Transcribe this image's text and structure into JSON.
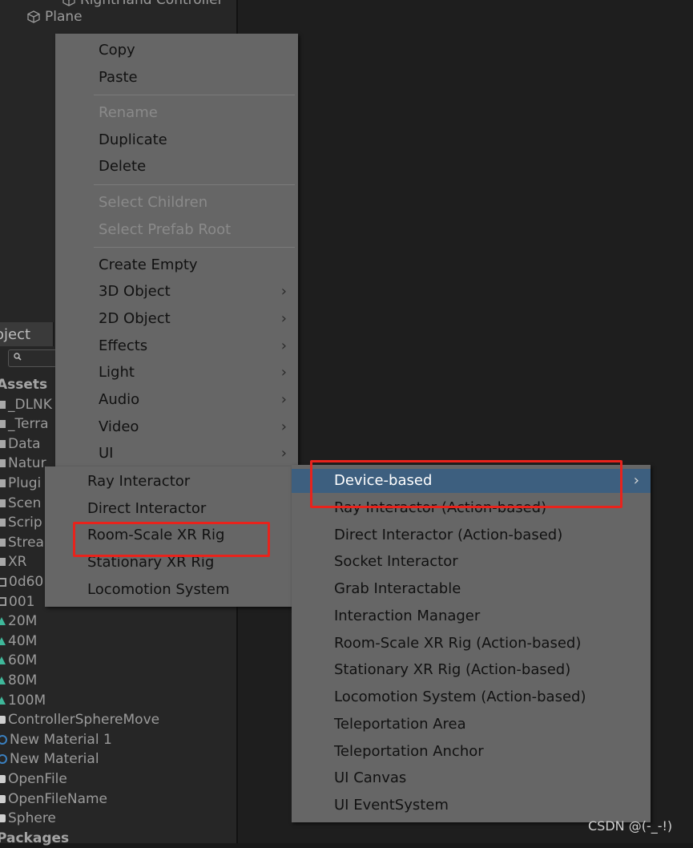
{
  "hierarchy": {
    "items": [
      {
        "label": "RightHand Controller",
        "icon": "cube-icon"
      },
      {
        "label": "Plane",
        "icon": "cube-icon"
      }
    ]
  },
  "project": {
    "tab_label": "oject",
    "search_icon": "search-icon",
    "items": [
      {
        "label": "Assets",
        "type": "header"
      },
      {
        "label": "_DLNK",
        "type": "folder"
      },
      {
        "label": "_Terra",
        "type": "folder"
      },
      {
        "label": "Data",
        "type": "folder"
      },
      {
        "label": "Natur",
        "type": "folder"
      },
      {
        "label": "Plugi",
        "type": "folder"
      },
      {
        "label": "Scen",
        "type": "folder"
      },
      {
        "label": "Scrip",
        "type": "folder"
      },
      {
        "label": "Strea",
        "type": "folder"
      },
      {
        "label": "XR",
        "type": "folder"
      },
      {
        "label": "0d60",
        "type": "mesh"
      },
      {
        "label": "001",
        "type": "mesh"
      },
      {
        "label": "20M",
        "type": "terrain"
      },
      {
        "label": "40M",
        "type": "terrain"
      },
      {
        "label": "60M",
        "type": "terrain"
      },
      {
        "label": "80M",
        "type": "terrain"
      },
      {
        "label": "100M",
        "type": "terrain"
      },
      {
        "label": "ControllerSphereMove",
        "type": "script"
      },
      {
        "label": "New Material 1",
        "type": "material"
      },
      {
        "label": "New Material",
        "type": "material"
      },
      {
        "label": "OpenFile",
        "type": "script"
      },
      {
        "label": "OpenFileName",
        "type": "script"
      },
      {
        "label": "Sphere",
        "type": "script"
      },
      {
        "label": "Packages",
        "type": "header"
      }
    ]
  },
  "main_menu": {
    "items": [
      {
        "label": "Copy",
        "enabled": true
      },
      {
        "label": "Paste",
        "enabled": true
      },
      {
        "label": "Rename",
        "enabled": false
      },
      {
        "label": "Duplicate",
        "enabled": true
      },
      {
        "label": "Delete",
        "enabled": true
      },
      {
        "label": "Select Children",
        "enabled": false
      },
      {
        "label": "Select Prefab Root",
        "enabled": false
      },
      {
        "label": "Create Empty",
        "enabled": true
      },
      {
        "label": "3D Object",
        "enabled": true,
        "submenu": true
      },
      {
        "label": "2D Object",
        "enabled": true,
        "submenu": true
      },
      {
        "label": "Effects",
        "enabled": true,
        "submenu": true
      },
      {
        "label": "Light",
        "enabled": true,
        "submenu": true
      },
      {
        "label": "Audio",
        "enabled": true,
        "submenu": true
      },
      {
        "label": "Video",
        "enabled": true,
        "submenu": true
      },
      {
        "label": "UI",
        "enabled": true,
        "submenu": true
      }
    ],
    "arrow": "›"
  },
  "xr_menu": {
    "items": [
      {
        "label": "Ray Interactor"
      },
      {
        "label": "Direct Interactor"
      },
      {
        "label": "Room-Scale XR Rig"
      },
      {
        "label": "Stationary XR Rig"
      },
      {
        "label": "Locomotion System"
      }
    ]
  },
  "sub_menu": {
    "items": [
      {
        "label": "Device-based",
        "highlight": true,
        "submenu": true
      },
      {
        "label": "Ray Interactor (Action-based)"
      },
      {
        "label": "Direct Interactor (Action-based)"
      },
      {
        "label": "Socket Interactor"
      },
      {
        "label": "Grab Interactable"
      },
      {
        "label": "Interaction Manager"
      },
      {
        "label": "Room-Scale XR Rig (Action-based)"
      },
      {
        "label": "Stationary XR Rig (Action-based)"
      },
      {
        "label": "Locomotion System (Action-based)"
      },
      {
        "label": "Teleportation Area"
      },
      {
        "label": "Teleportation Anchor"
      },
      {
        "label": "UI Canvas"
      },
      {
        "label": "UI EventSystem"
      }
    ]
  },
  "watermark": "CSDN @(-_-!)",
  "colors": {
    "menu_bg": "#666666",
    "highlight": "#3d5f7f",
    "annotation_red": "#e8231c"
  }
}
